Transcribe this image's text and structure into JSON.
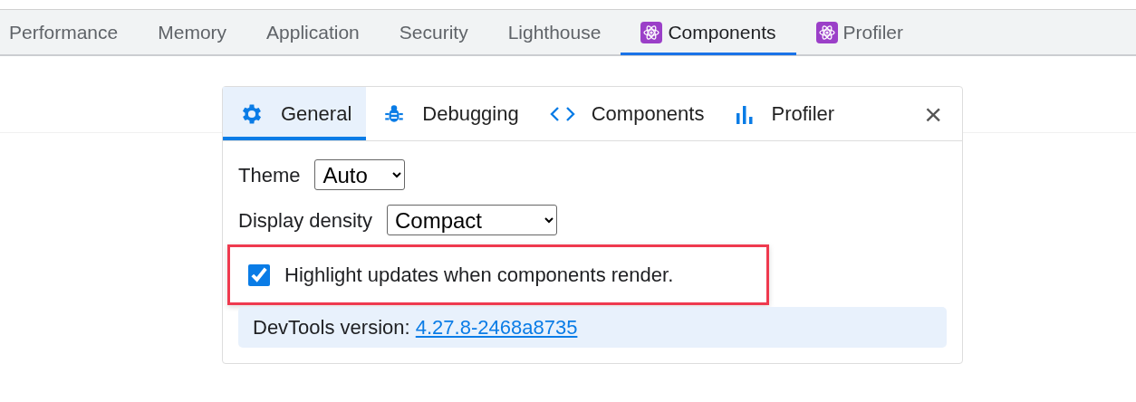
{
  "devtools_tabs": [
    {
      "label": "Performance",
      "selected": false,
      "icon": false
    },
    {
      "label": "Memory",
      "selected": false,
      "icon": false
    },
    {
      "label": "Application",
      "selected": false,
      "icon": false
    },
    {
      "label": "Security",
      "selected": false,
      "icon": false
    },
    {
      "label": "Lighthouse",
      "selected": false,
      "icon": false
    },
    {
      "label": "Components",
      "selected": true,
      "icon": true
    },
    {
      "label": "Profiler",
      "selected": false,
      "icon": true
    }
  ],
  "settings_tabs": [
    {
      "label": "General",
      "kind": "gear",
      "selected": true
    },
    {
      "label": "Debugging",
      "kind": "bug",
      "selected": false
    },
    {
      "label": "Components",
      "kind": "code",
      "selected": false
    },
    {
      "label": "Profiler",
      "kind": "chart",
      "selected": false
    }
  ],
  "close": "×",
  "theme": {
    "label": "Theme",
    "value": "Auto"
  },
  "density": {
    "label": "Display density",
    "value": "Compact"
  },
  "highlight": {
    "label": "Highlight updates when components render.",
    "checked": true,
    "annotated": true
  },
  "version": {
    "label": "DevTools version:",
    "link": "4.27.8-2468a8735"
  }
}
